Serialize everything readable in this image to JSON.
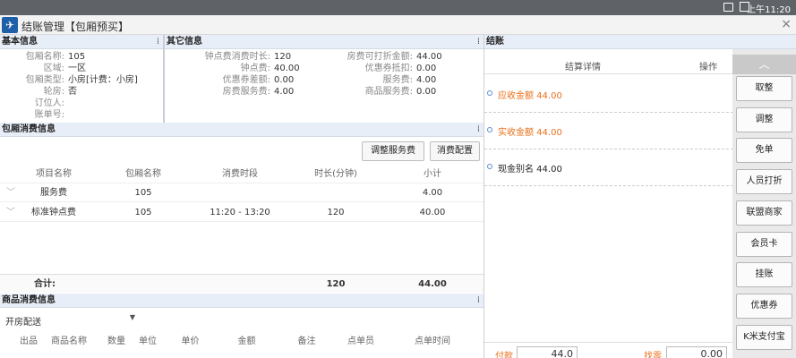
{
  "statusbar": {
    "time": "上午11:20"
  },
  "window": {
    "title": "结账管理【包厢预买】",
    "close": "×"
  },
  "basic": {
    "head": "基本信息",
    "rows": [
      {
        "label": "包厢名称:",
        "value": "105"
      },
      {
        "label": "区域:",
        "value": "一区"
      },
      {
        "label": "包厢类型:",
        "value": "小房[计费：小房]"
      },
      {
        "label": "轮房:",
        "value": "否"
      },
      {
        "label": "订位人:",
        "value": ""
      },
      {
        "label": "账单号:",
        "value": ""
      }
    ]
  },
  "other": {
    "head": "其它信息",
    "col1": [
      {
        "label": "钟点费消费时长:",
        "value": "120"
      },
      {
        "label": "钟点费:",
        "value": "40.00"
      },
      {
        "label": "优惠券差额:",
        "value": "0.00"
      },
      {
        "label": "房费服务费:",
        "value": "4.00"
      }
    ],
    "col2": [
      {
        "label": "房费可打折金额:",
        "value": "44.00"
      },
      {
        "label": "优惠券抵扣:",
        "value": "0.00"
      },
      {
        "label": "服务费:",
        "value": "4.00"
      },
      {
        "label": "商品服务费:",
        "value": "0.00"
      }
    ]
  },
  "room": {
    "head": "包厢消费信息",
    "btn_adjust": "调整服务费",
    "btn_config": "消费配置",
    "columns": [
      "项目名称",
      "包厢名称",
      "消费时段",
      "时长(分钟)",
      "小计"
    ],
    "rows": [
      {
        "name": "服务费",
        "room": "105",
        "period": "",
        "duration": "",
        "subtotal": "4.00"
      },
      {
        "name": "标准钟点费",
        "room": "105",
        "period": "11:20 - 13:20",
        "duration": "120",
        "subtotal": "40.00"
      }
    ],
    "total_label": "合计:",
    "total_duration": "120",
    "total_subtotal": "44.00"
  },
  "goods": {
    "head": "商品消费信息",
    "dropdown": "开房配送",
    "columns": [
      "出品",
      "商品名称",
      "数量",
      "单位",
      "单价",
      "金额",
      "备注",
      "点单员",
      "点单时间"
    ]
  },
  "settle": {
    "head": "结账",
    "col_detail": "结算详情",
    "col_op": "操作",
    "items": [
      {
        "text": "应收金额 44.00",
        "color": "#e8701a"
      },
      {
        "text": "实收金额 44.00",
        "color": "#e8701a"
      },
      {
        "text": "现金别名 44.00",
        "color": "#222222"
      }
    ],
    "pay_label": "付款",
    "pay_value": "44.0",
    "change_label": "找零",
    "change_value": "0.00"
  },
  "buttons": [
    "取整",
    "调整",
    "免单",
    "人员打折",
    "联盟商家",
    "会员卡",
    "挂账",
    "优惠券",
    "K米支付宝"
  ],
  "up_arrow": "︿"
}
